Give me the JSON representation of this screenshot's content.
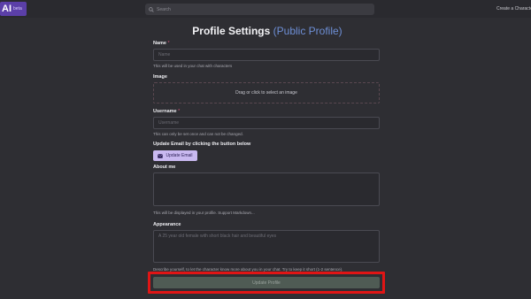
{
  "header": {
    "logo_mark": "AI",
    "logo_badge": "beta",
    "search_placeholder": "Search",
    "create_link": "Create a Characte"
  },
  "page": {
    "title_main": "Profile Settings",
    "title_accent": "(Public Profile)"
  },
  "form": {
    "name": {
      "label": "Name",
      "required_mark": "*",
      "placeholder": "Name",
      "hint": "This will be used in your chat with characters"
    },
    "image": {
      "label": "Image",
      "dropzone_text": "Drag or click to select an image"
    },
    "username": {
      "label": "Username",
      "required_mark": "*",
      "placeholder": "Username",
      "hint": "This can only be set once and can not be changed."
    },
    "email": {
      "label": "Update Email by clicking the button below",
      "button_label": "Update Email"
    },
    "about": {
      "label": "About me",
      "hint": "This will be displayed in your profile. Support Markdown..."
    },
    "appearance": {
      "label": "Appearance",
      "placeholder": "A 25 year old female with short black hair and beautiful eyes",
      "hint": "Describe yourself, to let the character know more about you in your chat. Try to keep it short (1-2 sentence)."
    },
    "submit_label": "Update Profile"
  },
  "colors": {
    "background": "#2e2e33",
    "accent": "#6e8fd6",
    "email_button": "#c9b9f0",
    "highlight": "#e01515"
  }
}
